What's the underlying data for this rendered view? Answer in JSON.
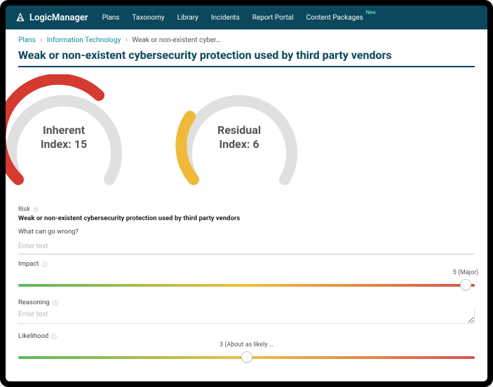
{
  "header": {
    "brand": "LogicManager",
    "nav": [
      {
        "label": "Plans"
      },
      {
        "label": "Taxonomy"
      },
      {
        "label": "Library"
      },
      {
        "label": "Incidents"
      },
      {
        "label": "Report Portal"
      },
      {
        "label": "Content Packages",
        "badge": "New"
      }
    ]
  },
  "breadcrumb": {
    "root": "Plans",
    "section": "Information Technology",
    "current": "Weak or non-existent cyber…"
  },
  "page_title": "Weak or non-existent cybersecurity protection used by third party vendors",
  "gauges": {
    "inherent": {
      "line1": "Inherent",
      "line2": "Index: 15"
    },
    "residual": {
      "line1": "Residual",
      "line2": "Index: 6"
    }
  },
  "risk": {
    "label": "Risk",
    "value": "Weak or non-existent cybersecurity protection used by third party vendors"
  },
  "fields": {
    "wrong": {
      "label": "What can go wrong?",
      "placeholder": "Enter text"
    },
    "impact": {
      "label": "Impact",
      "value_label": "5 (Major)",
      "position_pct": 98
    },
    "reasoning": {
      "label": "Reasoning",
      "placeholder": "Enter text"
    },
    "likelihood": {
      "label": "Likelihood",
      "value_label": "3 (About as likely …",
      "position_pct": 50
    }
  },
  "chart_data": [
    {
      "type": "gauge",
      "title": "Inherent Index",
      "value": 15,
      "range": [
        0,
        25
      ],
      "fill_color": "#d43a2f",
      "fill_fraction_approx": 0.55
    },
    {
      "type": "gauge",
      "title": "Residual Index",
      "value": 6,
      "range": [
        0,
        25
      ],
      "fill_color": "#f0b93a",
      "fill_fraction_approx": 0.22
    },
    {
      "type": "slider",
      "title": "Impact",
      "value": 5,
      "value_label": "5 (Major)",
      "range": [
        1,
        5
      ]
    },
    {
      "type": "slider",
      "title": "Likelihood",
      "value": 3,
      "value_label": "3 (About as likely …",
      "range": [
        1,
        5
      ]
    }
  ]
}
